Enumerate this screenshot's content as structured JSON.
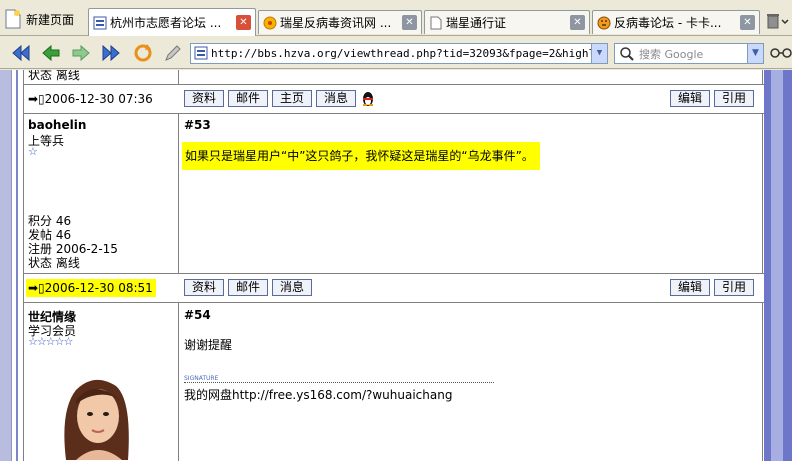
{
  "toolbar": {
    "new_page": "新建页面"
  },
  "tabs": [
    {
      "label": "杭州市志愿者论坛 ...",
      "active": true
    },
    {
      "label": "瑞星反病毒资讯网 ...",
      "active": false
    },
    {
      "label": "瑞星通行证",
      "active": false
    },
    {
      "label": "反病毒论坛 - 卡卡...",
      "active": false
    }
  ],
  "nav": {
    "url": "http://bbs.hzva.org/viewthread.php?tid=32093&fpage=2&highlight=",
    "search_placeholder": "搜索 Google"
  },
  "posts": {
    "prev": {
      "status_partial": "状态 离线",
      "timestamp": "2006-12-30 07:36",
      "buttons": [
        "资料",
        "邮件",
        "主页",
        "消息"
      ],
      "right_buttons": [
        "编辑",
        "引用"
      ]
    },
    "p53": {
      "author": "baohelin",
      "rank": "上等兵",
      "stars": "☆",
      "number": "#53",
      "message": "如果只是瑞星用户“中”这只鸽子，我怀疑这是瑞星的“乌龙事件”。",
      "stats": {
        "points": "积分 46",
        "posts": "发帖 46",
        "registered": "注册 2006-2-15",
        "status": "状态 离线"
      },
      "timestamp": "2006-12-30 08:51",
      "buttons": [
        "资料",
        "邮件",
        "消息"
      ],
      "right_buttons": [
        "编辑",
        "引用"
      ]
    },
    "p54": {
      "author": "世纪情缘",
      "rank": "学习会员",
      "stars": "☆☆☆☆☆",
      "number": "#54",
      "message": "谢谢提醒",
      "sig_mark": "SIGNATURE",
      "signature": "我的网盘http://free.ys168.com/?wuhuaichang"
    }
  },
  "colors": {
    "highlight": "#ffff00",
    "frame": "#808080",
    "scroll_accent": "#6d76c9"
  }
}
